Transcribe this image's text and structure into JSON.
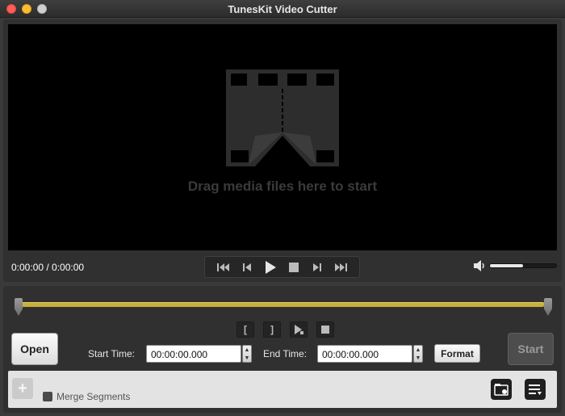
{
  "window": {
    "title": "TunesKit Video Cutter"
  },
  "preview": {
    "drop_hint": "Drag media files here to start",
    "time_readout": "0:00:00 / 0:00:00",
    "volume_level": 0.5
  },
  "transport": {
    "buttons": [
      "previous-icon",
      "step-back-icon",
      "play-icon",
      "stop-icon",
      "step-forward-icon",
      "next-icon"
    ]
  },
  "segment": {
    "mark_in_label": "[",
    "mark_out_label": "]"
  },
  "editor": {
    "open_label": "Open",
    "start_time_label": "Start Time:",
    "start_time_value": "00:00:00.000",
    "end_time_label": "End Time:",
    "end_time_value": "00:00:00.000",
    "format_label": "Format",
    "start_label": "Start"
  },
  "merge": {
    "add_label": "+",
    "merge_label": "Merge Segments",
    "merge_checked": false
  },
  "colors": {
    "timeline": "#c9b040",
    "background": "#3a3a3a",
    "video": "#000000"
  }
}
